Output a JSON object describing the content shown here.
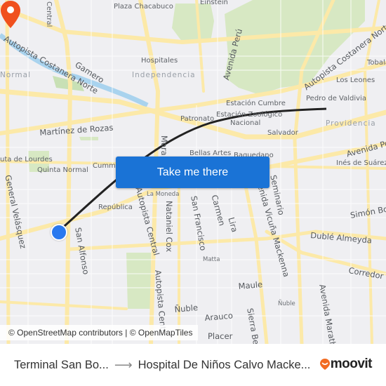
{
  "map": {
    "labels": {
      "central": "Central",
      "plaza_chacabuco": "Plaza Chacabuco",
      "einstein": "Einstein",
      "autopista_costanera_norte_w": "Autopista Costanera Norte",
      "autopista_costanera_norte_e": "Autopista Costanera Norte",
      "gamero": "Gamero",
      "hospitales": "Hospitales",
      "independencia": "Independencia",
      "normal": "Normal",
      "avenida_peru": "Avenida Perú",
      "tobalaba": "Tobala",
      "los_leones": "Los Leones",
      "pedro_de_valdivia": "Pedro de Valdivia",
      "providencia": "Providencia",
      "estacion_cumbre": "Estación Cumbre",
      "estacion_zoologico": "Estación Zoológico",
      "nacional": "Nacional",
      "patronato": "Patronato",
      "martinez_de_rozas": "Martínez de Rozas",
      "salvador": "Salvador",
      "avenida_pocuro": "Avenida Poc",
      "bellas_artes": "Bellas Artes",
      "baquedano": "Baquedano",
      "lourdes": "uta de Lourdes",
      "quinta_normal": "Quinta Normal",
      "cumming": "Cumming",
      "mora": "Mora",
      "ines_de_suarez": "Inés de Suárez",
      "la_moneda": "La Moneda",
      "general_velasquez": "General Velásquez",
      "republica": "República",
      "autopista_central": "Autopista Central",
      "nataniel_cox": "Nataniel Cox",
      "san_francisco": "San Francisco",
      "carmen": "Carmen",
      "lira": "Lira",
      "avenida_vicuna_mackenna": "Avenida Vicuña Mackenna",
      "seminario": "Seminario",
      "simon_bolivar": "Simón Bol",
      "duble_almeyda": "Dublé Almeyda",
      "san_alfonso": "San Alfonso",
      "matta": "Matta",
      "corredor": "Corredor T",
      "maule": "Maule",
      "avenida_marathon": "Avenida Maratho",
      "nuble_w": "Ñuble",
      "nuble_e": "Ñuble",
      "arauco": "Arauco",
      "sierra_bella": "Sierra Bella",
      "placer": "Placer",
      "autopista_central_s": "Autopista Centr"
    },
    "origin_icon": "origin-dot-icon",
    "destination_icon": "destination-pin-icon",
    "colors": {
      "route": "#222222",
      "origin": "#2979ef",
      "destination": "#f0501e",
      "road": "#fce9a8",
      "park": "#d7e8c3",
      "water": "#a9d3ee",
      "cta": "#1a73d6"
    }
  },
  "cta": {
    "label": "Take me there"
  },
  "attribution": "© OpenStreetMap contributors | © OpenMapTiles",
  "footer": {
    "from": "Terminal San Bo...",
    "arrow_icon": "arrow-right-icon",
    "to": "Hospital De Niños Calvo Macke...",
    "brand": "moovit",
    "brand_icon": "moovit-pin-icon"
  }
}
